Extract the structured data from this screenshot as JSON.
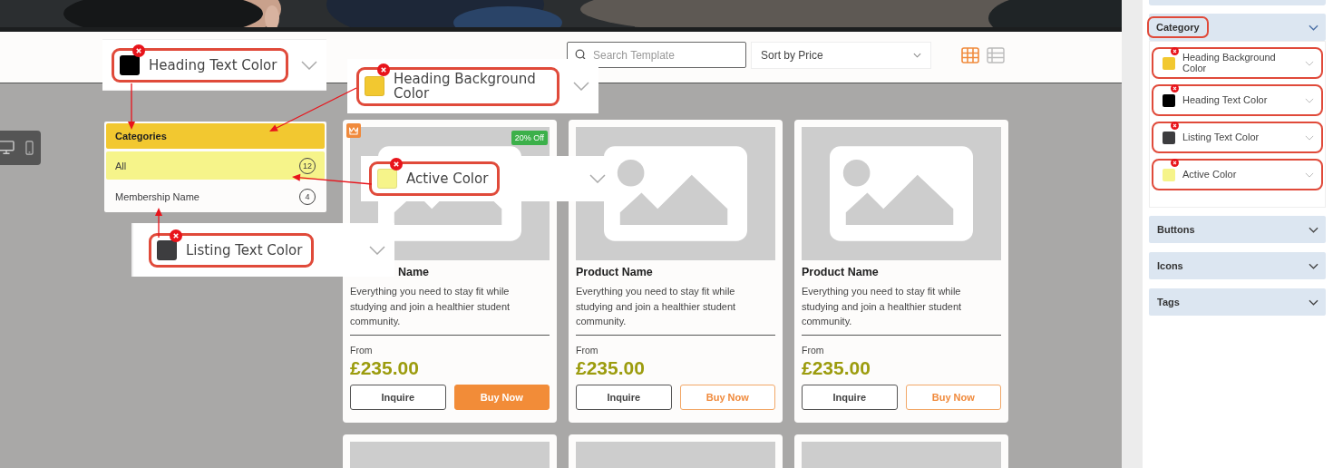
{
  "toolbar": {
    "search": {
      "placeholder": "Search Template"
    },
    "sort": {
      "value": "Sort by Price"
    },
    "views": [
      {
        "kind": "grid",
        "selected": true
      },
      {
        "kind": "list",
        "selected": false
      }
    ]
  },
  "device_toggle": [
    {
      "kind": "desktop"
    },
    {
      "kind": "mobile"
    }
  ],
  "categories": {
    "heading": "Categories",
    "items": [
      {
        "label": "All",
        "count": "12",
        "selected": true
      },
      {
        "label": "Membership Name",
        "count": "4",
        "selected": false
      }
    ]
  },
  "products": [
    {
      "name": "Name",
      "description": "Everything you need to stay fit while studying and join a healthier student community.",
      "from": "From",
      "price": "£235.00",
      "badge": "20% Off",
      "featured": true,
      "buttons": [
        {
          "label": "Inquire",
          "primary": false
        },
        {
          "label": "Buy Now",
          "primary": true
        }
      ]
    },
    {
      "name": "Product Name",
      "description": "Everything you need to stay fit while studying and join a healthier student community.",
      "from": "From",
      "price": "£235.00",
      "featured": false,
      "buttons": [
        {
          "label": "Inquire",
          "primary": false
        },
        {
          "label": "Buy Now",
          "primary": false
        }
      ]
    },
    {
      "name": "Product Name",
      "description": "Everything you need to stay fit while studying and join a healthier student community.",
      "from": "From",
      "price": "£235.00",
      "featured": false,
      "buttons": [
        {
          "label": "Inquire",
          "primary": false
        },
        {
          "label": "Buy Now",
          "primary": false
        }
      ]
    }
  ],
  "callouts": [
    {
      "label": "Heading Text Color",
      "color": "#000000"
    },
    {
      "label": "Heading Background Color",
      "color": "#f2c830"
    },
    {
      "label": "Active Color",
      "color": "#f6f48a"
    },
    {
      "label": "Listing Text Color",
      "color": "#3d3d3f"
    }
  ],
  "settings_panel": {
    "sections": [
      {
        "title": "Category",
        "expanded": true,
        "highlighted": true,
        "items": [
          {
            "label": "Heading Background Color",
            "color": "#f2c830",
            "highlighted": true
          },
          {
            "label": "Heading Text Color",
            "color": "#000000",
            "highlighted": true
          },
          {
            "label": "Listing Text Color",
            "color": "#3d3d3f",
            "highlighted": true
          },
          {
            "label": "Active Color",
            "color": "#f6f48a",
            "highlighted": true
          }
        ]
      },
      {
        "title": "Buttons",
        "expanded": false,
        "highlighted": false
      },
      {
        "title": "Icons",
        "expanded": false,
        "highlighted": false
      },
      {
        "title": "Tags",
        "expanded": false,
        "highlighted": false
      }
    ]
  }
}
